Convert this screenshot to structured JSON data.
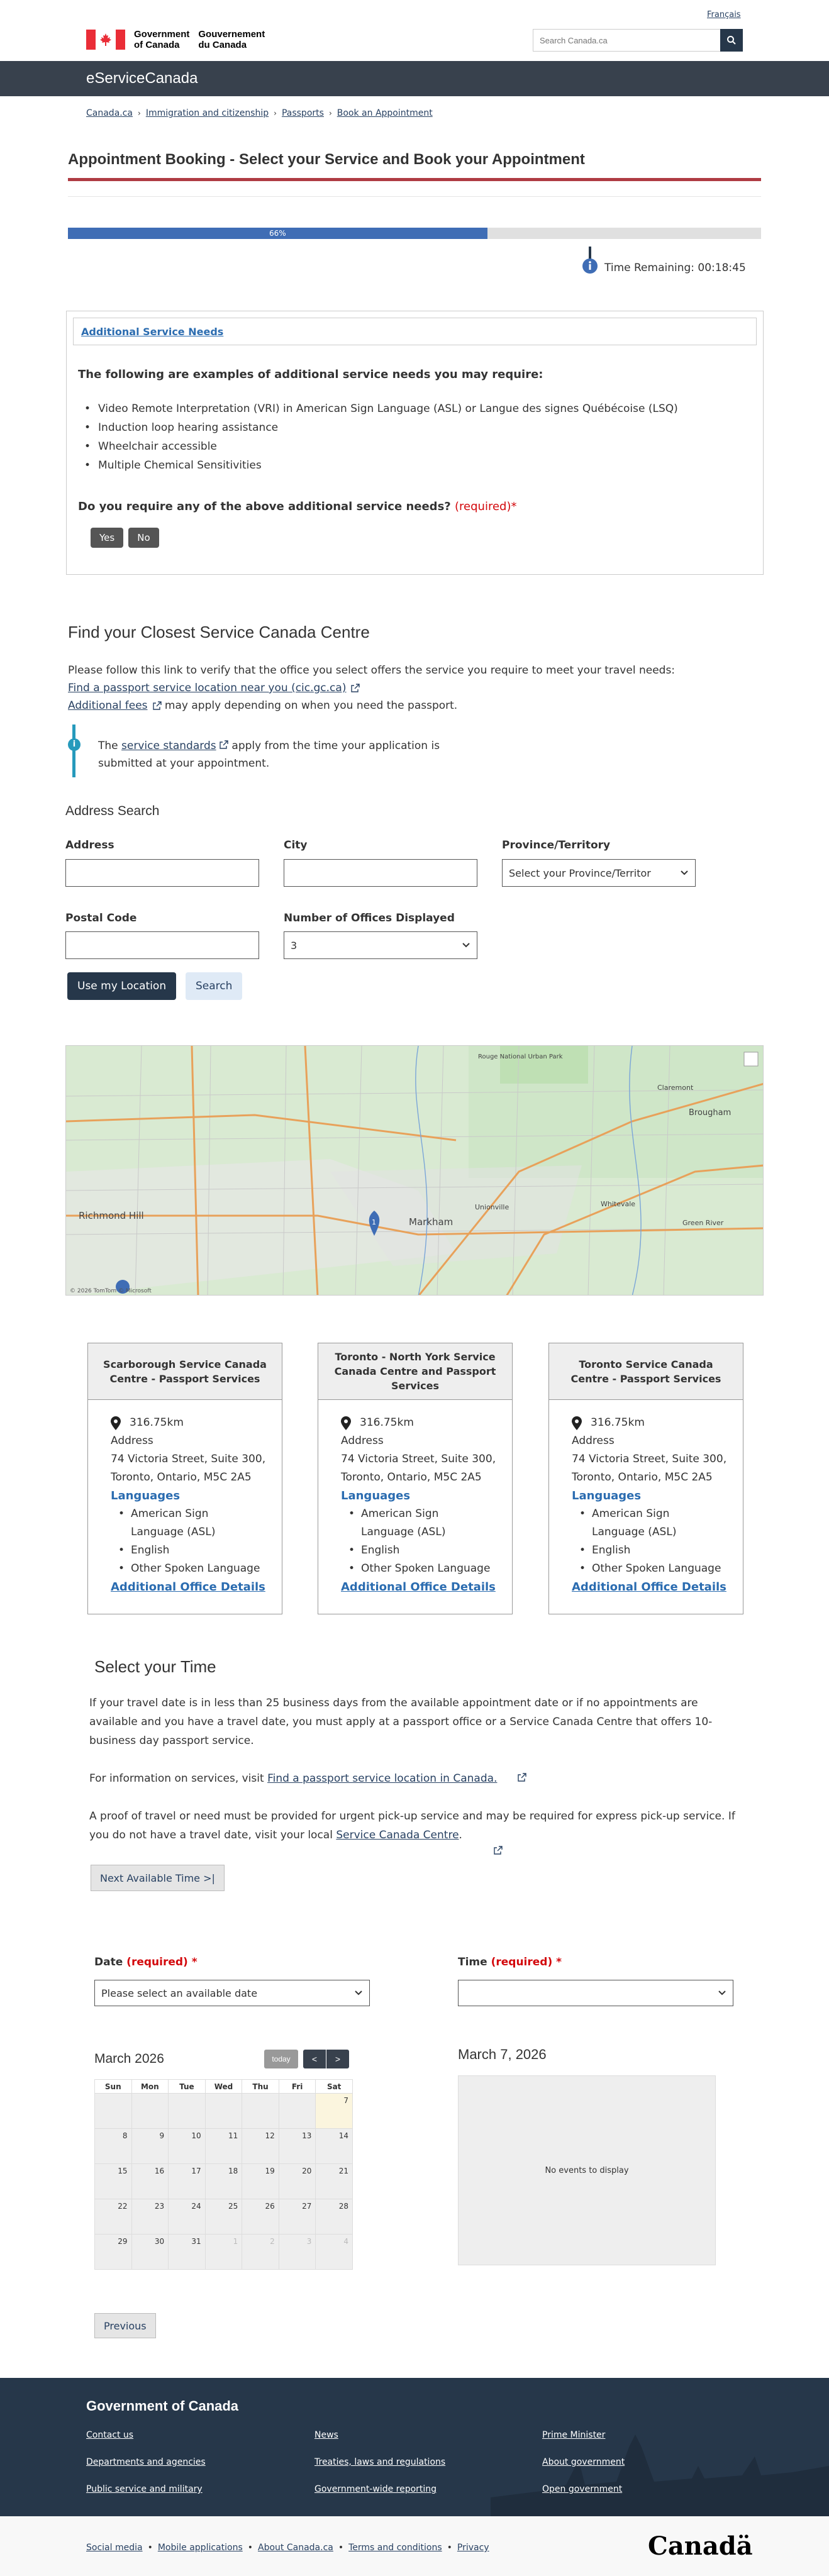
{
  "header": {
    "language_link": "Français",
    "gov_name_en_1": "Government",
    "gov_name_en_2": "of Canada",
    "gov_name_fr_1": "Gouvernement",
    "gov_name_fr_2": "du Canada",
    "search_placeholder": "Search Canada.ca",
    "app_name": "eServiceCanada"
  },
  "breadcrumb": [
    "Canada.ca",
    "Immigration and citizenship",
    "Passports",
    "Book an Appointment"
  ],
  "page_title": "Appointment Booking - Select your Service and Book your Appointment",
  "progress": {
    "label": "66%",
    "value": 0.605
  },
  "timer": {
    "text": "Time Remaining: 00:18:45"
  },
  "service_needs": {
    "header_link": "Additional Service Needs",
    "lead": "The following are examples of additional service needs you may require:",
    "items": [
      "Video Remote Interpretation (VRI) in American Sign Language (ASL) or Langue des signes Québécoise (LSQ)",
      "Induction loop hearing assistance",
      "Wheelchair accessible",
      "Multiple Chemical Sensitivities"
    ],
    "question": "Do you require any of the above additional service needs?",
    "required": "(required)*",
    "yes": "Yes",
    "no": "No"
  },
  "find": {
    "title": "Find your Closest Service Canada Centre",
    "intro": "Please follow this link to verify that the office you select offers the service you require to meet your travel needs:",
    "link1": "Find a passport service location near you (cic.gc.ca)",
    "link2": "Additional fees",
    "link2_suffix": "may apply depending on when you need the passport.",
    "info_prefix": "The",
    "info_link": "service standards",
    "info_suffix": "apply from the time your application is submitted at your appointment."
  },
  "address_search": {
    "title": "Address Search",
    "address_label": "Address",
    "city_label": "City",
    "province_label": "Province/Territory",
    "province_value": "Select your Province/Territor",
    "postal_label": "Postal Code",
    "offices_label": "Number of Offices Displayed",
    "offices_value": "3",
    "use_location": "Use my Location",
    "search": "Search"
  },
  "map": {
    "labels": [
      "Rouge National Urban Park",
      "Brougham",
      "Richmond Hill",
      "Markham",
      "Unionville",
      "Whitevale",
      "Green River",
      "Claremont"
    ],
    "copyright": "© 2026 TomTom © Microsoft"
  },
  "offices": [
    {
      "name": "Scarborough Service Canada Centre - Passport Services",
      "distance": "316.75km",
      "address_label": "Address",
      "address_1": "74 Victoria Street, Suite 300,",
      "address_2": "Toronto, Ontario, M5C 2A5",
      "languages_label": "Languages",
      "languages": [
        "American Sign Language (ASL)",
        "English",
        "Other Spoken Language"
      ],
      "details": "Additional Office Details"
    },
    {
      "name": "Toronto - North York Service Canada Centre and Passport Services",
      "distance": "316.75km",
      "address_label": "Address",
      "address_1": "74 Victoria Street, Suite 300,",
      "address_2": "Toronto, Ontario, M5C 2A5",
      "languages_label": "Languages",
      "languages": [
        "American Sign Language (ASL)",
        "English",
        "Other Spoken Language"
      ],
      "details": "Additional Office Details"
    },
    {
      "name": "Toronto Service Canada Centre - Passport Services",
      "distance": "316.75km",
      "address_label": "Address",
      "address_1": "74 Victoria Street, Suite 300,",
      "address_2": "Toronto, Ontario, M5C 2A5",
      "languages_label": "Languages",
      "languages": [
        "American Sign Language (ASL)",
        "English",
        "Other Spoken Language"
      ],
      "details": "Additional Office Details"
    }
  ],
  "time": {
    "title": "Select your Time",
    "para1": "If your travel date is in less than 25 business days from the available appointment date or if no appointments are available and you have a travel date, you must apply at a passport office or a Service Canada Centre that offers 10-business day passport service.",
    "para2_prefix": "For information on services, visit",
    "para2_link": "Find a passport service location in Canada.",
    "para3": "A proof of travel or need must be provided for urgent pick-up service and may be required for express pick-up service. If you do not have a travel date, visit your local",
    "para3_link": "Service Canada Centre",
    "next_available": "Next Available Time >|",
    "date_label": "Date",
    "date_required": "(required) *",
    "date_value": "Please select an available date",
    "time_label": "Time",
    "time_required": "(required) *",
    "time_value": ""
  },
  "calendar": {
    "month": "March 2026",
    "today": "today",
    "prev": "<",
    "next": ">",
    "weekdays": [
      "Sun",
      "Mon",
      "Tue",
      "Wed",
      "Thu",
      "Fri",
      "Sat"
    ],
    "weeks": [
      [
        "",
        "",
        "",
        "",
        "",
        "",
        "7"
      ],
      [
        "8",
        "9",
        "10",
        "11",
        "12",
        "13",
        "14"
      ],
      [
        "15",
        "16",
        "17",
        "18",
        "19",
        "20",
        "21"
      ],
      [
        "22",
        "23",
        "24",
        "25",
        "26",
        "27",
        "28"
      ],
      [
        "29",
        "30",
        "31",
        "1",
        "2",
        "3",
        "4"
      ]
    ],
    "selected_date": "March 7, 2026",
    "no_events": "No events to display"
  },
  "previous": "Previous",
  "footer": {
    "title": "Government of Canada",
    "links": [
      "Contact us",
      "News",
      "Prime Minister",
      "Departments and agencies",
      "Treaties, laws and regulations",
      "About government",
      "Public service and military",
      "Government-wide reporting",
      "Open government"
    ],
    "sub_links": [
      "Social media",
      "Mobile applications",
      "About Canada.ca",
      "Terms and conditions",
      "Privacy"
    ],
    "wordmark": "Canadä"
  },
  "colors": {
    "navy": "#26374a",
    "appbar": "#38414d",
    "accent_red": "#af3c43",
    "progress": "#3f6db5",
    "info": "#269abc"
  }
}
